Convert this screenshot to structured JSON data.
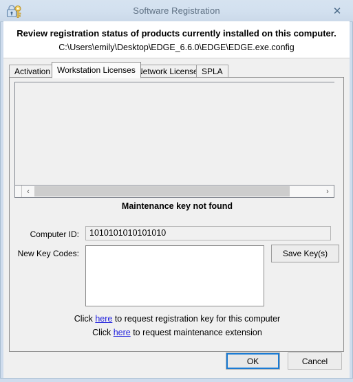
{
  "window": {
    "title": "Software Registration",
    "icon": "lock-key-icon",
    "close_label": "✕",
    "border_color": "#cfdced"
  },
  "header": {
    "heading": "Review registration status of products currently installed on this computer.",
    "config_path": "C:\\Users\\emily\\Desktop\\EDGE_6.6.0\\EDGE\\EDGE.exe.config"
  },
  "tabs": [
    {
      "label": "Activation",
      "active": false
    },
    {
      "label": "Workstation Licenses",
      "active": true
    },
    {
      "label": "Network Licenses",
      "active": false
    },
    {
      "label": "SPLA",
      "active": false
    }
  ],
  "license_list": {
    "rows": [],
    "empty": true
  },
  "scrollbar": {
    "left_arrow": "‹",
    "right_arrow": "›",
    "thumb_fraction": "89%"
  },
  "status": {
    "message": "Maintenance key not found"
  },
  "form": {
    "computer_id_label": "Computer ID:",
    "computer_id_value": "1010101010101010",
    "new_key_codes_label": "New Key Codes:",
    "new_key_codes_value": "",
    "new_key_codes_placeholder": "",
    "save_button_label": "Save Key(s)"
  },
  "links": {
    "line1_prefix": "Click ",
    "line1_link": "here",
    "line1_suffix": " to request registration key for this computer",
    "line2_prefix": "Click ",
    "line2_link": "here",
    "line2_suffix": " to request maintenance extension",
    "link_color": "#2222dd"
  },
  "footer": {
    "ok_label": "OK",
    "cancel_label": "Cancel",
    "focus_color": "#1a7bd4"
  }
}
